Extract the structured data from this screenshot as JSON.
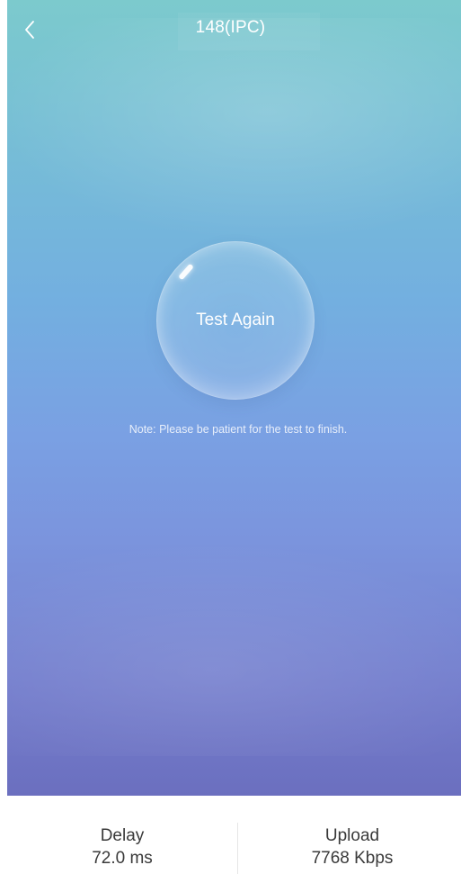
{
  "header": {
    "title": "148(IPC)",
    "back_icon": "chevron-left-icon"
  },
  "test": {
    "button_label": "Test Again",
    "note": "Note: Please be patient for the test to finish."
  },
  "stats": {
    "delay": {
      "label": "Delay",
      "value": "72.0 ms"
    },
    "upload": {
      "label": "Upload",
      "value": "7768 Kbps"
    }
  },
  "colors": {
    "gradient_top": "#7ccacd",
    "gradient_mid": "#73afe0",
    "gradient_bottom": "#6b6fbf",
    "text_light": "#ffffff",
    "text_dark": "#3a3a3a"
  }
}
